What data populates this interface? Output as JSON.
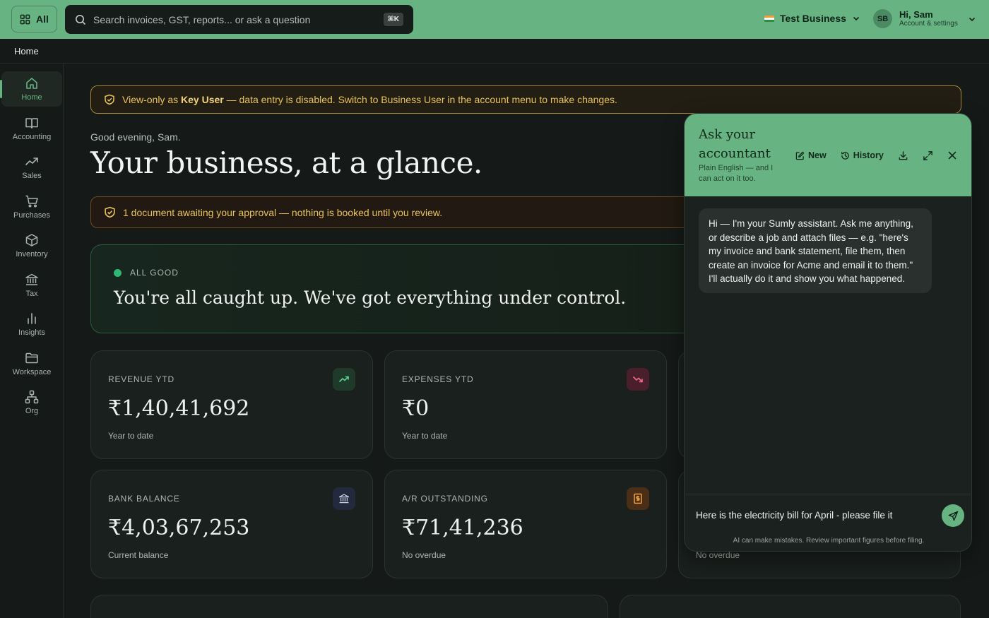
{
  "topbar": {
    "all_label": "All",
    "search_placeholder": "Search invoices, GST, reports... or ask a question",
    "search_shortcut": "⌘K",
    "business_name": "Test Business",
    "user_initials": "SB",
    "user_greeting": "Hi, Sam",
    "user_sub": "Account & settings"
  },
  "breadcrumb": "Home",
  "sidebar": {
    "items": [
      {
        "label": "Home",
        "icon": "home-icon"
      },
      {
        "label": "Accounting",
        "icon": "book-icon"
      },
      {
        "label": "Sales",
        "icon": "trend-up-icon"
      },
      {
        "label": "Purchases",
        "icon": "cart-icon"
      },
      {
        "label": "Inventory",
        "icon": "box-icon"
      },
      {
        "label": "Tax",
        "icon": "bank-icon"
      },
      {
        "label": "Insights",
        "icon": "bar-chart-icon"
      },
      {
        "label": "Workspace",
        "icon": "folder-icon"
      },
      {
        "label": "Org",
        "icon": "org-chart-icon"
      }
    ]
  },
  "notice": {
    "pre": "View-only as ",
    "role": "Key User",
    "post": " — data entry is disabled. Switch to Business User in the account menu to make changes."
  },
  "greeting": "Good evening, Sam.",
  "headline": "Your business, at a glance.",
  "approval": "1 document awaiting your approval — nothing is booked until you review.",
  "status": {
    "label": "ALL GOOD",
    "message": "You're all caught up. We've got everything under control."
  },
  "cards": [
    {
      "label": "REVENUE YTD",
      "value": "₹1,40,41,692",
      "sub": "Year to date"
    },
    {
      "label": "EXPENSES YTD",
      "value": "₹0",
      "sub": "Year to date"
    },
    {
      "label": "BANK BALANCE",
      "value": "₹4,03,67,253",
      "sub": "Current balance"
    },
    {
      "label": "A/R OUTSTANDING",
      "value": "₹71,41,236",
      "sub": "No overdue"
    },
    {
      "label": "",
      "value": "",
      "sub": "No overdue"
    }
  ],
  "assistant": {
    "title": "Ask your accountant",
    "subtitle": "Plain English — and I can act on it too.",
    "new_label": "New",
    "history_label": "History",
    "message": "Hi — I'm your Sumly assistant. Ask me anything, or describe a job and attach files — e.g. \"here's my invoice and bank statement, file them, then create an invoice for Acme and email it to them.\" I'll actually do it and show you what happened.",
    "input_value": "Here is the electricity bill for April - please file it",
    "disclaimer": "AI can make mistakes. Review important figures before filing."
  },
  "colors": {
    "accent": "#67b482",
    "background": "#151a18",
    "warning": "#e8c35a",
    "success_dot": "#2eb872"
  }
}
